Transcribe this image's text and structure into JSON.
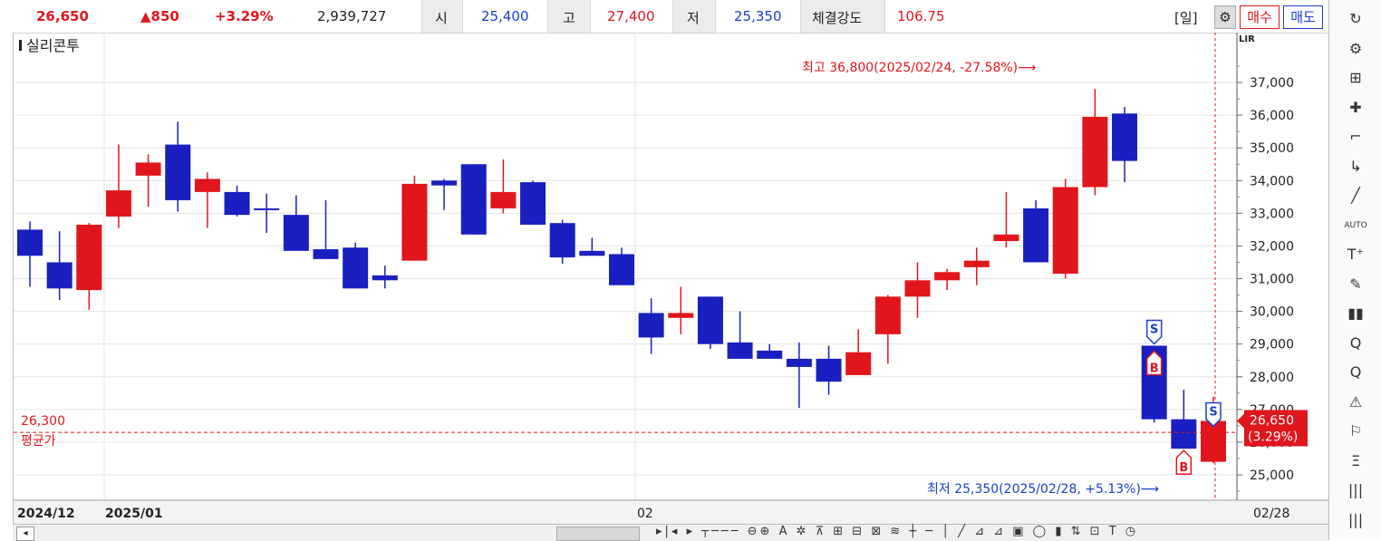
{
  "header": {
    "price": "26,650",
    "change": "▲850",
    "change_pct": "+3.29%",
    "volume": "2,939,727",
    "open_label": "시",
    "open": "25,400",
    "high_label": "고",
    "high": "27,400",
    "low_label": "저",
    "low": "25,350",
    "strength_label": "체결강도",
    "strength": "106.75",
    "period": "[일]",
    "buy": "매수",
    "sell": "매도"
  },
  "colors": {
    "up": "#e0161c",
    "down": "#1a1fc0",
    "grid": "#e6e6e6"
  },
  "chart_data": {
    "type": "candlestick",
    "title": "실리콘투",
    "ylim": [
      24500,
      37800
    ],
    "y_ticks": [
      "25,000",
      "26,000",
      "27,000",
      "28,000",
      "29,000",
      "30,000",
      "31,000",
      "32,000",
      "33,000",
      "34,000",
      "35,000",
      "36,000",
      "37,000"
    ],
    "x_labels": [
      "2024/12",
      "2025/01",
      "02",
      "02/28"
    ],
    "candles": [
      {
        "o": 32500,
        "h": 32750,
        "l": 30750,
        "c": 31700
      },
      {
        "o": 31500,
        "h": 32450,
        "l": 30350,
        "c": 30700
      },
      {
        "o": 30650,
        "h": 32700,
        "l": 30050,
        "c": 32650
      },
      {
        "o": 32900,
        "h": 35100,
        "l": 32550,
        "c": 33700
      },
      {
        "o": 34150,
        "h": 34800,
        "l": 33200,
        "c": 34550
      },
      {
        "o": 35100,
        "h": 35800,
        "l": 33050,
        "c": 33400
      },
      {
        "o": 33650,
        "h": 34250,
        "l": 32550,
        "c": 34050
      },
      {
        "o": 33650,
        "h": 33850,
        "l": 32900,
        "c": 32950
      },
      {
        "o": 33150,
        "h": 33600,
        "l": 32400,
        "c": 33100
      },
      {
        "o": 32950,
        "h": 33550,
        "l": 31850,
        "c": 31850
      },
      {
        "o": 31900,
        "h": 33400,
        "l": 31600,
        "c": 31600
      },
      {
        "o": 31950,
        "h": 32100,
        "l": 30700,
        "c": 30700
      },
      {
        "o": 31100,
        "h": 31400,
        "l": 30700,
        "c": 30950
      },
      {
        "o": 31550,
        "h": 34150,
        "l": 31550,
        "c": 33900
      },
      {
        "o": 34000,
        "h": 34050,
        "l": 33100,
        "c": 33850
      },
      {
        "o": 34500,
        "h": 34500,
        "l": 32350,
        "c": 32350
      },
      {
        "o": 33150,
        "h": 34650,
        "l": 33000,
        "c": 33650
      },
      {
        "o": 33950,
        "h": 34000,
        "l": 32650,
        "c": 32650
      },
      {
        "o": 32700,
        "h": 32800,
        "l": 31450,
        "c": 31650
      },
      {
        "o": 31850,
        "h": 32250,
        "l": 31750,
        "c": 31700
      },
      {
        "o": 31750,
        "h": 31950,
        "l": 30800,
        "c": 30800
      },
      {
        "o": 29950,
        "h": 30400,
        "l": 28700,
        "c": 29200
      },
      {
        "o": 29800,
        "h": 30750,
        "l": 29300,
        "c": 29950
      },
      {
        "o": 30450,
        "h": 30450,
        "l": 28850,
        "c": 29000
      },
      {
        "o": 29050,
        "h": 30000,
        "l": 28550,
        "c": 28550
      },
      {
        "o": 28800,
        "h": 29000,
        "l": 28550,
        "c": 28550
      },
      {
        "o": 28550,
        "h": 29050,
        "l": 27050,
        "c": 28300
      },
      {
        "o": 28550,
        "h": 28950,
        "l": 27450,
        "c": 27850
      },
      {
        "o": 28050,
        "h": 29450,
        "l": 28050,
        "c": 28750
      },
      {
        "o": 29300,
        "h": 30500,
        "l": 28400,
        "c": 30450
      },
      {
        "o": 30450,
        "h": 31500,
        "l": 29800,
        "c": 30950
      },
      {
        "o": 30950,
        "h": 31300,
        "l": 30650,
        "c": 31200
      },
      {
        "o": 31350,
        "h": 31950,
        "l": 30800,
        "c": 31550
      },
      {
        "o": 32150,
        "h": 33650,
        "l": 31950,
        "c": 32350
      },
      {
        "o": 33150,
        "h": 33400,
        "l": 31500,
        "c": 31500
      },
      {
        "o": 31150,
        "h": 34050,
        "l": 31000,
        "c": 33800
      },
      {
        "o": 33800,
        "h": 36800,
        "l": 33550,
        "c": 35950
      },
      {
        "o": 36050,
        "h": 36250,
        "l": 33950,
        "c": 34600
      },
      {
        "o": 28950,
        "h": 28950,
        "l": 26600,
        "c": 26700
      },
      {
        "o": 26700,
        "h": 27600,
        "l": 25800,
        "c": 25800
      },
      {
        "o": 25400,
        "h": 27400,
        "l": 25350,
        "c": 26650
      }
    ],
    "annotations": {
      "high_text": "최고 36,800(2025/02/24, -27.58%)⟶",
      "low_text": "최저 25,350(2025/02/28, +5.13%)⟶",
      "avg_price": 26300,
      "avg_price_label": "26,300",
      "avg_label": "평균가",
      "current_price": 26650,
      "current_label": "26,650",
      "current_pct": "(3.29%)",
      "marker_s": "S",
      "marker_b": "B"
    }
  },
  "bottom": {
    "scroll_left": "◂",
    "icons": "▸|◂ ▸ ┬─── ⊖⊕ A ✲ ⊼ ⊞ ⊟ ⊠ ≋ ┼ ─ │ ╱ ⊿ ⊿ ▣ ◯ ▮ ⇅ ⊡ T ◷"
  },
  "toolbar_right": {
    "icons": [
      "↻",
      "⚙",
      "⊞",
      "✚",
      "⌐",
      "↳",
      "╱",
      "AUTO",
      "T⁺",
      "✎",
      "▮▮",
      "Q",
      "Q",
      "⚠",
      "⚐",
      "Ξ",
      "|||",
      "|||"
    ]
  }
}
